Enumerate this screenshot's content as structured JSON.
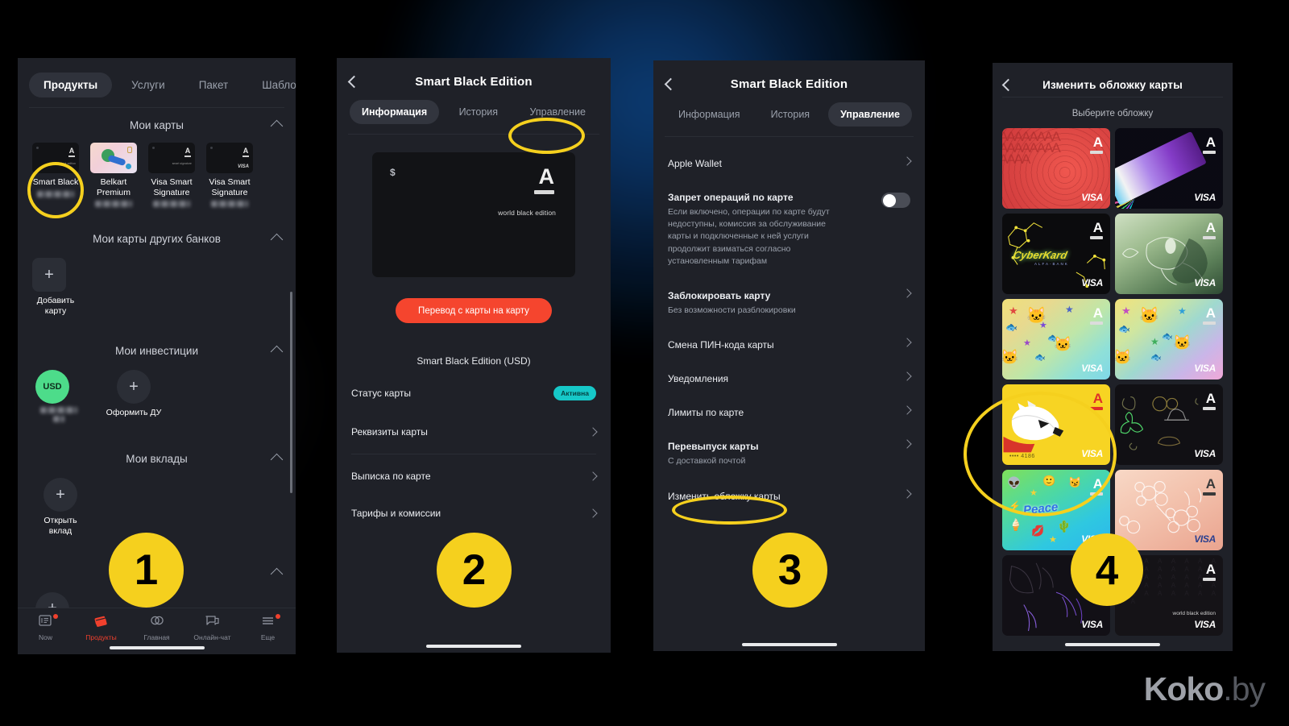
{
  "watermark": {
    "strong": "Koko",
    "light": ".by"
  },
  "phone1": {
    "tabs": [
      {
        "label": "Продукты",
        "active": true
      },
      {
        "label": "Услуги",
        "active": false
      },
      {
        "label": "Пакет",
        "active": false
      },
      {
        "label": "Шаблоны",
        "active": false
      }
    ],
    "sections": [
      {
        "title": "Мои карты",
        "collapse_icon": "chevron-up-icon"
      },
      {
        "title": "Мои карты других банков",
        "collapse_icon": "chevron-up-icon"
      },
      {
        "title": "Мои инвестиции",
        "collapse_icon": "chevron-up-icon"
      },
      {
        "title": "Мои вклады",
        "collapse_icon": "chevron-up-icon"
      }
    ],
    "my_cards": [
      {
        "name": "Smart Black",
        "brand": "alfa",
        "masked": "•••• ••••"
      },
      {
        "name": "Belkart Premium",
        "brand": "belkart",
        "masked": "•••• ••••"
      },
      {
        "name": "Visa Smart Signature",
        "brand": "visa",
        "masked": "•••• ••••"
      },
      {
        "name": "Visa Smart Signature",
        "brand": "visa",
        "masked": "•••• ••••"
      }
    ],
    "add_card_label": "Добавить карту",
    "investment_currency": "USD",
    "open_du_label": "Оформить ДУ",
    "open_deposit_label": "Открыть вклад",
    "bottom_nav": [
      {
        "label": "Now",
        "icon": "news-icon",
        "active": false,
        "badge": true
      },
      {
        "label": "Продукты",
        "icon": "cards-icon",
        "active": true,
        "badge": false
      },
      {
        "label": "Главная",
        "icon": "circles-icon",
        "active": false,
        "badge": false
      },
      {
        "label": "Онлайн-чат",
        "icon": "chat-icon",
        "active": false,
        "badge": false
      },
      {
        "label": "Еще",
        "icon": "menu-icon",
        "active": false,
        "badge": true
      }
    ]
  },
  "phone2": {
    "back_icon": "back-chevron-icon",
    "title": "Smart Black Edition",
    "segments": [
      {
        "label": "Информация",
        "active": true
      },
      {
        "label": "История",
        "active": false
      },
      {
        "label": "Управление",
        "active": false,
        "highlighted": true
      }
    ],
    "card": {
      "currency_symbol": "$",
      "logo": "A",
      "tagline": "world black edition"
    },
    "transfer_button": "Перевод с карты на карту",
    "card_caption": "Smart Black Edition (USD)",
    "rows": [
      {
        "label": "Статус карты",
        "badge": "Активна",
        "chevron": false
      },
      {
        "label": "Реквизиты карты",
        "badge": null,
        "chevron": true
      },
      {
        "label": "Выписка по карте",
        "badge": null,
        "chevron": true
      },
      {
        "label": "Тарифы и комиссии",
        "badge": null,
        "chevron": true
      }
    ]
  },
  "phone3": {
    "back_icon": "back-chevron-icon",
    "title": "Smart Black Edition",
    "segments": [
      {
        "label": "Информация",
        "active": false
      },
      {
        "label": "История",
        "active": false
      },
      {
        "label": "Управление",
        "active": true
      }
    ],
    "rows": [
      {
        "title": "Apple Wallet",
        "sub": null,
        "control": "chevron",
        "bold": false
      },
      {
        "title": "Запрет операций по карте",
        "sub": "Если включено, операции по карте будут недоступны, комиссия за обслуживание карты и подключенные к ней услуги продолжит взиматься согласно установленным тарифам",
        "control": "toggle",
        "toggle_on": false,
        "bold": true
      },
      {
        "title": "Заблокировать карту",
        "sub": "Без возможности разблокировки",
        "control": "chevron",
        "bold": true
      },
      {
        "title": "Смена ПИН-кода карты",
        "sub": null,
        "control": "chevron",
        "bold": false
      },
      {
        "title": "Уведомления",
        "sub": null,
        "control": "chevron",
        "bold": false
      },
      {
        "title": "Лимиты по карте",
        "sub": null,
        "control": "chevron",
        "bold": false
      },
      {
        "title": "Перевыпуск карты",
        "sub": "С доставкой почтой",
        "control": "chevron",
        "bold": true
      },
      {
        "title": "Изменить обложку карты",
        "sub": null,
        "control": "chevron",
        "bold": false,
        "highlighted": true
      }
    ]
  },
  "phone4": {
    "back_icon": "back-chevron-icon",
    "title": "Изменить обложку карты",
    "subtitle": "Выберите обложку",
    "covers": [
      {
        "name": "red-ornament",
        "payment": "VISA",
        "logo": "A",
        "selected": false
      },
      {
        "name": "neon-rays",
        "payment": "VISA",
        "logo": "A",
        "selected": false
      },
      {
        "name": "cyberkard",
        "payment": "VISA",
        "logo": "A",
        "caption": "CyberKard",
        "sub_caption": "ALFA-BANK",
        "selected": false
      },
      {
        "name": "koi-fish-green",
        "payment": "VISA",
        "logo": "A",
        "selected": false
      },
      {
        "name": "cats-fish-warm",
        "payment": "VISA",
        "logo": "A",
        "selected": false
      },
      {
        "name": "cats-fish-pink",
        "payment": "VISA",
        "logo": "A",
        "selected": false
      },
      {
        "name": "bull-terrier-yellow",
        "payment": "VISA",
        "logo": "A",
        "masked": "•••• 4186",
        "selected": true
      },
      {
        "name": "luck-charms-dark",
        "payment": "VISA",
        "logo": "A",
        "selected": false
      },
      {
        "name": "stickers-peace",
        "payment": "VISA",
        "logo": "A",
        "selected": false
      },
      {
        "name": "sakura-peach",
        "payment": "VISA",
        "logo": "A",
        "selected": false
      },
      {
        "name": "dark-leaves-violet",
        "payment": "VISA",
        "logo": "A",
        "selected": false
      },
      {
        "name": "world-black-edition",
        "payment": "VISA",
        "logo": "A",
        "caption": "world black edition",
        "selected": false
      }
    ]
  },
  "annotations": [
    {
      "number": "1",
      "phone": 1
    },
    {
      "number": "2",
      "phone": 2
    },
    {
      "number": "3",
      "phone": 3
    },
    {
      "number": "4",
      "phone": 4
    }
  ],
  "colors": {
    "accent_yellow": "#f5d01e",
    "accent_red": "#f5452e",
    "badge_teal": "#16c8c8",
    "phone_bg": "#1f2128"
  }
}
